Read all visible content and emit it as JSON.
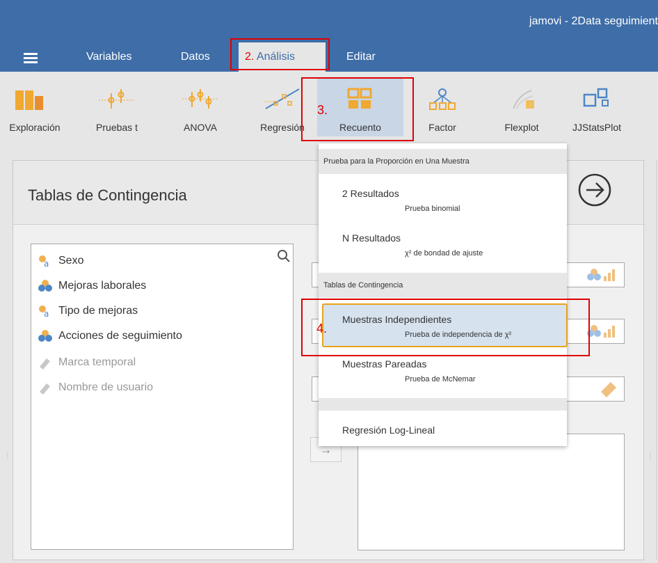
{
  "app_title": "jamovi - 2Data seguimient",
  "menu_tabs": {
    "variables": "Variables",
    "datos": "Datos",
    "analisis": "Análisis",
    "editar": "Editar"
  },
  "ribbon": [
    "Exploración",
    "Pruebas t",
    "ANOVA",
    "Regresión",
    "Recuento",
    "Factor",
    "Flexplot",
    "JJStatsPlot"
  ],
  "panel": {
    "title": "Tablas de Contingencia"
  },
  "variables": [
    {
      "name": "Sexo",
      "icon": "nominal-text-icon",
      "enabled": true
    },
    {
      "name": "Mejoras laborales",
      "icon": "nominal-icon",
      "enabled": true
    },
    {
      "name": "Tipo de mejoras",
      "icon": "nominal-text-icon",
      "enabled": true
    },
    {
      "name": "Acciones de seguimiento",
      "icon": "nominal-icon",
      "enabled": true
    },
    {
      "name": "Marca temporal",
      "icon": "id-icon",
      "enabled": false
    },
    {
      "name": "Nombre de usuario",
      "icon": "id-icon",
      "enabled": false
    }
  ],
  "dropdown": {
    "group1": "Prueba para la Proporción en Una Muestra",
    "item1": {
      "title": "2 Resultados",
      "sub": "Prueba binomial"
    },
    "item2": {
      "title": "N Resultados",
      "sub": "χ² de bondad de ajuste"
    },
    "group2": "Tablas de Contingencia",
    "item3": {
      "title": "Muestras Independientes",
      "sub": "Prueba de independencia de χ²"
    },
    "item4": {
      "title": "Muestras Pareadas",
      "sub": "Prueba de McNemar"
    },
    "item5": {
      "title": "Regresión Log-Lineal"
    }
  },
  "annotations": {
    "a2": "2.",
    "a3": "3.",
    "a4": "4."
  },
  "colors": {
    "header": "#3e6da8",
    "annotation": "#e00000",
    "selected_border": "#e8a317",
    "icon_orange": "#f0a830",
    "icon_blue": "#4c86c6"
  }
}
